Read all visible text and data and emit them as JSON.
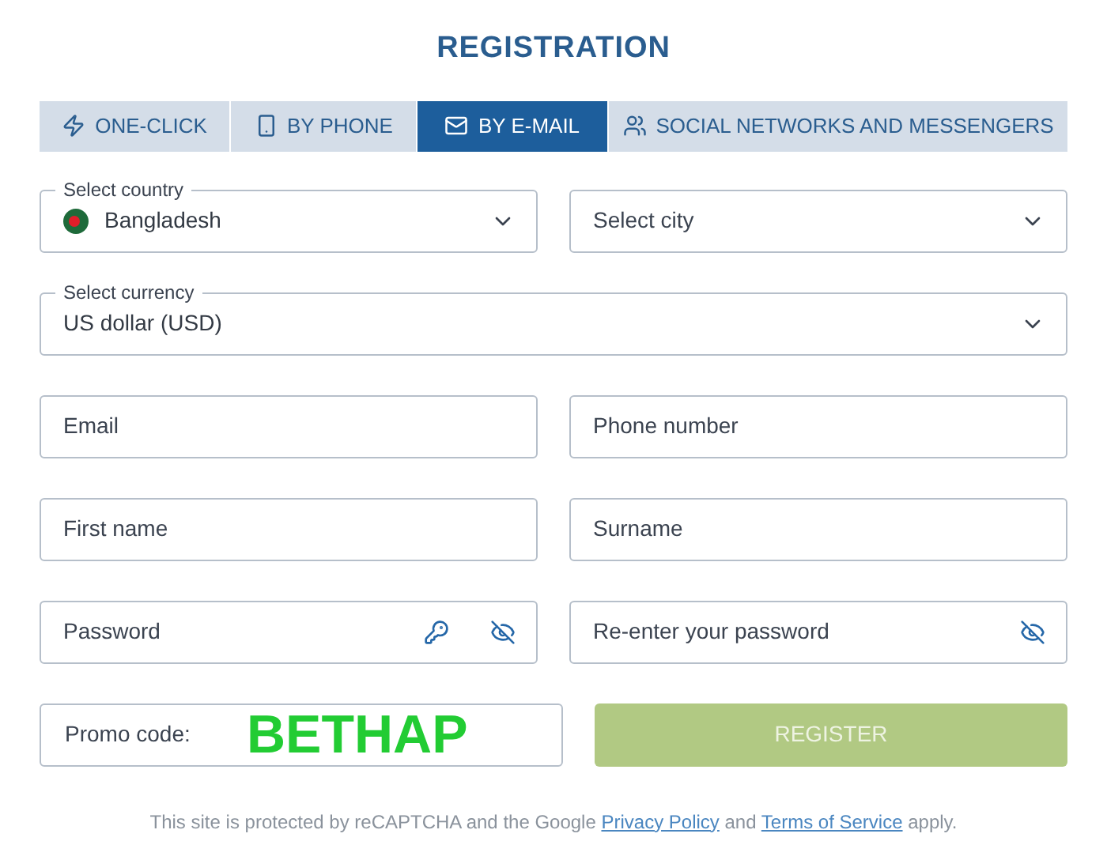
{
  "title": "REGISTRATION",
  "tabs": [
    {
      "label": "ONE-CLICK",
      "selected": false
    },
    {
      "label": "BY PHONE",
      "selected": false
    },
    {
      "label": "BY E-MAIL",
      "selected": true
    },
    {
      "label": "SOCIAL NETWORKS AND MESSENGERS",
      "selected": false
    }
  ],
  "rows": [
    [
      {
        "kind": "select",
        "label": "Select country",
        "value": "Bangladesh",
        "flag": true
      },
      {
        "kind": "select",
        "placeholder": "Select city"
      }
    ],
    [
      {
        "kind": "select",
        "label": "Select currency",
        "value": "US dollar (USD)"
      }
    ],
    [
      {
        "kind": "input",
        "placeholder": "Email"
      },
      {
        "kind": "input",
        "placeholder": "Phone number"
      }
    ],
    [
      {
        "kind": "input",
        "placeholder": "First name"
      },
      {
        "kind": "input",
        "placeholder": "Surname"
      }
    ],
    [
      {
        "kind": "password",
        "placeholder": "Password",
        "generator": true
      },
      {
        "kind": "password",
        "placeholder": "Re-enter your password",
        "generator": false
      }
    ],
    [
      {
        "kind": "promo",
        "label": "Promo code:",
        "value": "BETHAP"
      },
      {
        "kind": "button",
        "label": "REGISTER",
        "disabled": true
      }
    ]
  ],
  "footer": [
    {
      "kind": "text",
      "text": "This site is protected by reCAPTCHA and the Google "
    },
    {
      "kind": "link",
      "text": "Privacy Policy"
    },
    {
      "kind": "text",
      "text": " and "
    },
    {
      "kind": "link",
      "text": "Terms of Service"
    },
    {
      "kind": "text",
      "text": " apply."
    }
  ]
}
